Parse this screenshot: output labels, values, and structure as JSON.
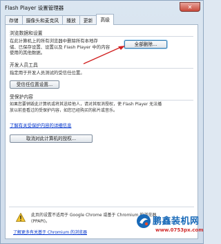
{
  "window": {
    "title": "Flash Player 设置管理器",
    "close_glyph": "✕"
  },
  "tabs": [
    {
      "label": "存储"
    },
    {
      "label": "摄像头和麦克风"
    },
    {
      "label": "播放"
    },
    {
      "label": "更新"
    },
    {
      "label": "高级"
    }
  ],
  "browsing": {
    "title": "浏览数据和设置",
    "desc1": "在此计算机上的所有浏览器中删除所有本地存",
    "desc2": "储、已保存设置、设置以及 Flash Player 中的内容",
    "desc3": "使用的其他数据。",
    "delete_all_label": "全部删除..."
  },
  "developer": {
    "title": "开发人员工具",
    "desc": "指定用于开发人员测试的受信任位置。",
    "trusted_btn_label": "受信任位置设置..."
  },
  "protected": {
    "title": "受保护内容",
    "desc1": "如果您要销毁此计算机或将其送给他人，请对其取消授权，使 Flash Player 无法播",
    "desc2": "放以前查看过的受保护内容，如您已经购买的影片或音乐。",
    "learn_link": "了解有关受保护内容的详细信息",
    "deauth_btn_label": "取消对此计算机的授权..."
  },
  "notice": {
    "line1": "此页的设置不适用于 Google Chrome 或基于 Chromium 的浏览器",
    "line2": "(PPAPI)。",
    "link": "了解更多有关基于 Chromium 的浏览器"
  },
  "watermark": {
    "brand": "鹏鑫装机网",
    "url": "www.0753px.com"
  },
  "colors": {
    "accent": "#1869b8",
    "link": "#0033cc",
    "arrow": "#d12020"
  }
}
